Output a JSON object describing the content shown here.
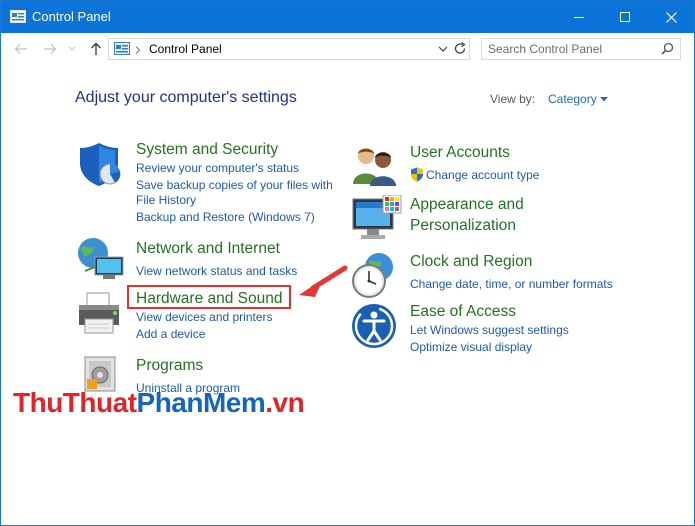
{
  "window": {
    "title": "Control Panel",
    "accent": "#0a74d8"
  },
  "address": {
    "breadcrumb": "Control Panel"
  },
  "search": {
    "placeholder": "Search Control Panel"
  },
  "main": {
    "heading": "Adjust your computer's settings",
    "view_by_label": "View by:",
    "view_by_value": "Category"
  },
  "categories_left": [
    {
      "title": "System and Security",
      "icon": "shield-icon",
      "links": [
        "Review your computer's status",
        "Save backup copies of your files with",
        "File History",
        "Backup and Restore (Windows 7)"
      ]
    },
    {
      "title": "Network and Internet",
      "icon": "network-icon",
      "links": [
        "View network status and tasks"
      ]
    },
    {
      "title": "Hardware and Sound",
      "icon": "printer-icon",
      "highlighted": true,
      "links": [
        "View devices and printers",
        "Add a device"
      ]
    },
    {
      "title": "Programs",
      "icon": "programs-icon",
      "links": [
        "Uninstall a program"
      ]
    }
  ],
  "categories_right": [
    {
      "title": "User Accounts",
      "icon": "users-icon",
      "links": [
        "Change account type"
      ]
    },
    {
      "title_line1": "Appearance and",
      "title_line2": "Personalization",
      "icon": "monitor-icon"
    },
    {
      "title": "Clock and Region",
      "icon": "clock-globe-icon",
      "links": [
        "Change date, time, or number formats"
      ]
    },
    {
      "title": "Ease of Access",
      "icon": "ease-of-access-icon",
      "links": [
        "Let Windows suggest settings",
        "Optimize visual display"
      ]
    }
  ],
  "watermark": {
    "part1": "ThuThuat",
    "part2": "PhanMem",
    "part3": ".vn"
  },
  "colors": {
    "category_title": "#227322",
    "link": "#1e58b8",
    "heading": "#1e3287",
    "highlight": "#e03030"
  }
}
